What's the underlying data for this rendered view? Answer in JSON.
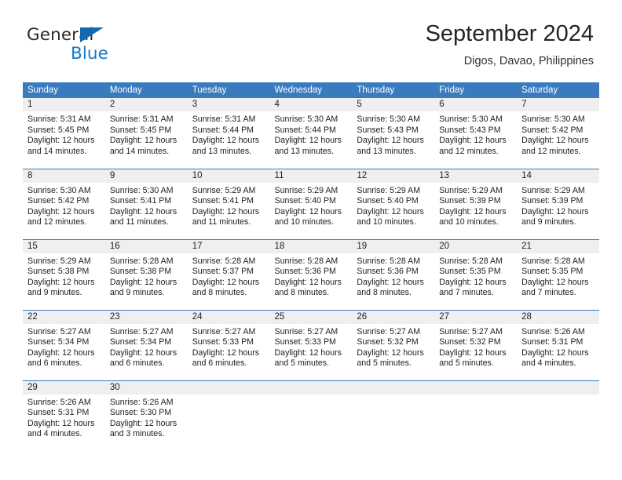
{
  "brand": {
    "name_part1": "General",
    "name_part2": "Blue",
    "flag_icon": "triangle-flag-icon"
  },
  "header": {
    "title": "September 2024",
    "location": "Digos, Davao, Philippines"
  },
  "colors": {
    "header_blue": "#3a7bbf",
    "brand_blue": "#1877c6",
    "daynum_band": "#efefef",
    "text": "#1e1e1e"
  },
  "calendar": {
    "weekday_headers": [
      "Sunday",
      "Monday",
      "Tuesday",
      "Wednesday",
      "Thursday",
      "Friday",
      "Saturday"
    ],
    "weeks": [
      [
        {
          "day": "1",
          "sunrise": "Sunrise: 5:31 AM",
          "sunset": "Sunset: 5:45 PM",
          "daylight_line1": "Daylight: 12 hours",
          "daylight_line2": "and 14 minutes."
        },
        {
          "day": "2",
          "sunrise": "Sunrise: 5:31 AM",
          "sunset": "Sunset: 5:45 PM",
          "daylight_line1": "Daylight: 12 hours",
          "daylight_line2": "and 14 minutes."
        },
        {
          "day": "3",
          "sunrise": "Sunrise: 5:31 AM",
          "sunset": "Sunset: 5:44 PM",
          "daylight_line1": "Daylight: 12 hours",
          "daylight_line2": "and 13 minutes."
        },
        {
          "day": "4",
          "sunrise": "Sunrise: 5:30 AM",
          "sunset": "Sunset: 5:44 PM",
          "daylight_line1": "Daylight: 12 hours",
          "daylight_line2": "and 13 minutes."
        },
        {
          "day": "5",
          "sunrise": "Sunrise: 5:30 AM",
          "sunset": "Sunset: 5:43 PM",
          "daylight_line1": "Daylight: 12 hours",
          "daylight_line2": "and 13 minutes."
        },
        {
          "day": "6",
          "sunrise": "Sunrise: 5:30 AM",
          "sunset": "Sunset: 5:43 PM",
          "daylight_line1": "Daylight: 12 hours",
          "daylight_line2": "and 12 minutes."
        },
        {
          "day": "7",
          "sunrise": "Sunrise: 5:30 AM",
          "sunset": "Sunset: 5:42 PM",
          "daylight_line1": "Daylight: 12 hours",
          "daylight_line2": "and 12 minutes."
        }
      ],
      [
        {
          "day": "8",
          "sunrise": "Sunrise: 5:30 AM",
          "sunset": "Sunset: 5:42 PM",
          "daylight_line1": "Daylight: 12 hours",
          "daylight_line2": "and 12 minutes."
        },
        {
          "day": "9",
          "sunrise": "Sunrise: 5:30 AM",
          "sunset": "Sunset: 5:41 PM",
          "daylight_line1": "Daylight: 12 hours",
          "daylight_line2": "and 11 minutes."
        },
        {
          "day": "10",
          "sunrise": "Sunrise: 5:29 AM",
          "sunset": "Sunset: 5:41 PM",
          "daylight_line1": "Daylight: 12 hours",
          "daylight_line2": "and 11 minutes."
        },
        {
          "day": "11",
          "sunrise": "Sunrise: 5:29 AM",
          "sunset": "Sunset: 5:40 PM",
          "daylight_line1": "Daylight: 12 hours",
          "daylight_line2": "and 10 minutes."
        },
        {
          "day": "12",
          "sunrise": "Sunrise: 5:29 AM",
          "sunset": "Sunset: 5:40 PM",
          "daylight_line1": "Daylight: 12 hours",
          "daylight_line2": "and 10 minutes."
        },
        {
          "day": "13",
          "sunrise": "Sunrise: 5:29 AM",
          "sunset": "Sunset: 5:39 PM",
          "daylight_line1": "Daylight: 12 hours",
          "daylight_line2": "and 10 minutes."
        },
        {
          "day": "14",
          "sunrise": "Sunrise: 5:29 AM",
          "sunset": "Sunset: 5:39 PM",
          "daylight_line1": "Daylight: 12 hours",
          "daylight_line2": "and 9 minutes."
        }
      ],
      [
        {
          "day": "15",
          "sunrise": "Sunrise: 5:29 AM",
          "sunset": "Sunset: 5:38 PM",
          "daylight_line1": "Daylight: 12 hours",
          "daylight_line2": "and 9 minutes."
        },
        {
          "day": "16",
          "sunrise": "Sunrise: 5:28 AM",
          "sunset": "Sunset: 5:38 PM",
          "daylight_line1": "Daylight: 12 hours",
          "daylight_line2": "and 9 minutes."
        },
        {
          "day": "17",
          "sunrise": "Sunrise: 5:28 AM",
          "sunset": "Sunset: 5:37 PM",
          "daylight_line1": "Daylight: 12 hours",
          "daylight_line2": "and 8 minutes."
        },
        {
          "day": "18",
          "sunrise": "Sunrise: 5:28 AM",
          "sunset": "Sunset: 5:36 PM",
          "daylight_line1": "Daylight: 12 hours",
          "daylight_line2": "and 8 minutes."
        },
        {
          "day": "19",
          "sunrise": "Sunrise: 5:28 AM",
          "sunset": "Sunset: 5:36 PM",
          "daylight_line1": "Daylight: 12 hours",
          "daylight_line2": "and 8 minutes."
        },
        {
          "day": "20",
          "sunrise": "Sunrise: 5:28 AM",
          "sunset": "Sunset: 5:35 PM",
          "daylight_line1": "Daylight: 12 hours",
          "daylight_line2": "and 7 minutes."
        },
        {
          "day": "21",
          "sunrise": "Sunrise: 5:28 AM",
          "sunset": "Sunset: 5:35 PM",
          "daylight_line1": "Daylight: 12 hours",
          "daylight_line2": "and 7 minutes."
        }
      ],
      [
        {
          "day": "22",
          "sunrise": "Sunrise: 5:27 AM",
          "sunset": "Sunset: 5:34 PM",
          "daylight_line1": "Daylight: 12 hours",
          "daylight_line2": "and 6 minutes."
        },
        {
          "day": "23",
          "sunrise": "Sunrise: 5:27 AM",
          "sunset": "Sunset: 5:34 PM",
          "daylight_line1": "Daylight: 12 hours",
          "daylight_line2": "and 6 minutes."
        },
        {
          "day": "24",
          "sunrise": "Sunrise: 5:27 AM",
          "sunset": "Sunset: 5:33 PM",
          "daylight_line1": "Daylight: 12 hours",
          "daylight_line2": "and 6 minutes."
        },
        {
          "day": "25",
          "sunrise": "Sunrise: 5:27 AM",
          "sunset": "Sunset: 5:33 PM",
          "daylight_line1": "Daylight: 12 hours",
          "daylight_line2": "and 5 minutes."
        },
        {
          "day": "26",
          "sunrise": "Sunrise: 5:27 AM",
          "sunset": "Sunset: 5:32 PM",
          "daylight_line1": "Daylight: 12 hours",
          "daylight_line2": "and 5 minutes."
        },
        {
          "day": "27",
          "sunrise": "Sunrise: 5:27 AM",
          "sunset": "Sunset: 5:32 PM",
          "daylight_line1": "Daylight: 12 hours",
          "daylight_line2": "and 5 minutes."
        },
        {
          "day": "28",
          "sunrise": "Sunrise: 5:26 AM",
          "sunset": "Sunset: 5:31 PM",
          "daylight_line1": "Daylight: 12 hours",
          "daylight_line2": "and 4 minutes."
        }
      ],
      [
        {
          "day": "29",
          "sunrise": "Sunrise: 5:26 AM",
          "sunset": "Sunset: 5:31 PM",
          "daylight_line1": "Daylight: 12 hours",
          "daylight_line2": "and 4 minutes."
        },
        {
          "day": "30",
          "sunrise": "Sunrise: 5:26 AM",
          "sunset": "Sunset: 5:30 PM",
          "daylight_line1": "Daylight: 12 hours",
          "daylight_line2": "and 3 minutes."
        },
        {
          "day": "",
          "sunrise": "",
          "sunset": "",
          "daylight_line1": "",
          "daylight_line2": ""
        },
        {
          "day": "",
          "sunrise": "",
          "sunset": "",
          "daylight_line1": "",
          "daylight_line2": ""
        },
        {
          "day": "",
          "sunrise": "",
          "sunset": "",
          "daylight_line1": "",
          "daylight_line2": ""
        },
        {
          "day": "",
          "sunrise": "",
          "sunset": "",
          "daylight_line1": "",
          "daylight_line2": ""
        },
        {
          "day": "",
          "sunrise": "",
          "sunset": "",
          "daylight_line1": "",
          "daylight_line2": ""
        }
      ]
    ]
  }
}
